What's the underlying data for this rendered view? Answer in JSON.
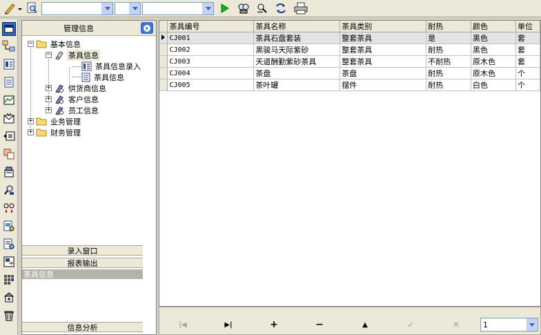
{
  "toolbar": {
    "combo1_value": "",
    "combo2_value": "",
    "combo3_value": "",
    "icons": [
      "pencil-icon",
      "search-icon",
      "run-icon",
      "find-icon",
      "find-next-icon",
      "refresh-icon",
      "print-icon"
    ]
  },
  "vbar_icons": [
    "window-icon",
    "network-icon",
    "form-icon",
    "document-icon",
    "chart-icon",
    "mail-icon",
    "module-icon",
    "grid-icon",
    "settings-icon",
    "search-user-icon",
    "link-icon",
    "report-icon",
    "edit-doc-icon",
    "export-icon",
    "table-icon",
    "config-icon",
    "trash-icon"
  ],
  "left_panel": {
    "header": "管理信息",
    "tree": {
      "basic_info": "基本信息",
      "tea_info": "茶具信息",
      "tea_entry": "茶具信息录入",
      "tea_info_view": "茶具信息",
      "supplier": "供货商信息",
      "customer": "客户信息",
      "employee": "员工信息",
      "business": "业务管理",
      "finance": "财务管理"
    },
    "sections": {
      "entry_window": "录入窗口",
      "report_output": "报表输出",
      "selected_item": "茶具信息",
      "analysis": "信息分析"
    }
  },
  "grid": {
    "columns": [
      "茶具编号",
      "茶具名称",
      "茶具类别",
      "耐热",
      "颜色",
      "单位"
    ],
    "rows": [
      [
        "CJ001",
        "茶具石盘套装",
        "整套茶具",
        "是",
        "黑色",
        "套"
      ],
      [
        "CJ002",
        "黑骏马天际紫砂",
        "整套茶具",
        "耐热",
        "黑色",
        "套"
      ],
      [
        "CJ003",
        "天道酬勤紫砂茶具",
        "整套茶具",
        "不耐热",
        "原木色",
        "套"
      ],
      [
        "CJ004",
        "茶盘",
        "茶盘",
        "耐热",
        "原木色",
        "个"
      ],
      [
        "CJ005",
        "茶叶罐",
        "摆件",
        "耐热",
        "白色",
        "个"
      ]
    ]
  },
  "nav": {
    "first": "|◀",
    "last": "▶|",
    "add": "+",
    "delete": "−",
    "up": "▲",
    "confirm": "✓",
    "cancel": "✕",
    "page": "1"
  }
}
